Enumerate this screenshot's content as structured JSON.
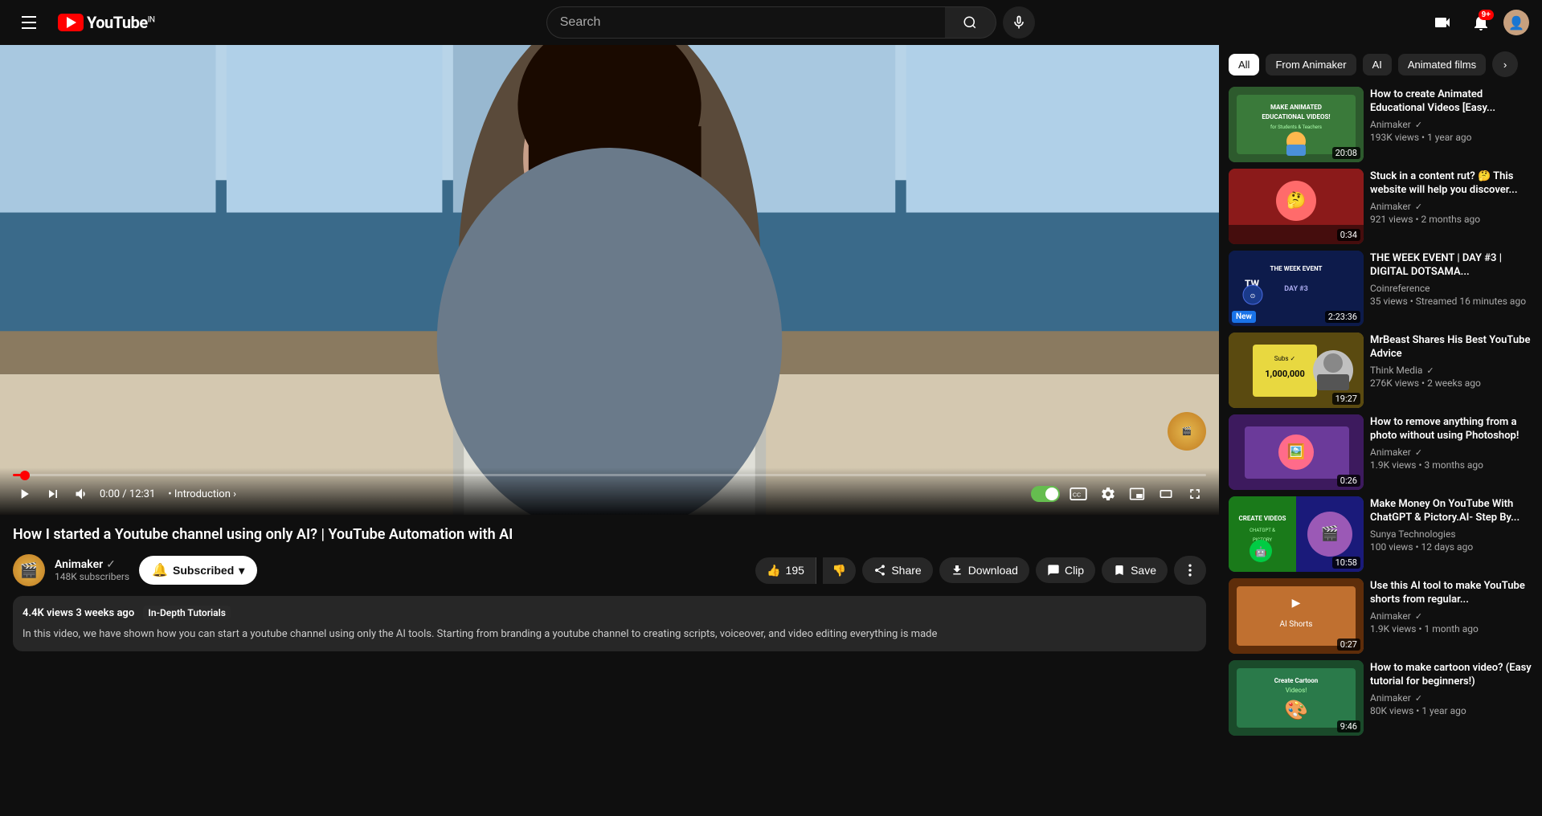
{
  "header": {
    "search_placeholder": "Search",
    "logo_text": "YouTube",
    "logo_sup": "IN",
    "notification_badge": "9+"
  },
  "video": {
    "title": "How I started a Youtube channel using only AI? | YouTube Automation with AI",
    "time_current": "0:00",
    "time_total": "12:31",
    "chapter": "Introduction",
    "views": "4.4K views",
    "posted": "3 weeks ago",
    "category": "In-Depth Tutorials",
    "description": "In this video, we have shown how you can start a youtube channel using only the AI tools. Starting from branding a youtube channel to creating scripts, voiceover, and video editing everything is made"
  },
  "channel": {
    "name": "Animaker",
    "verified": true,
    "subscribers": "148K subscribers",
    "subscribed": true,
    "subscribe_label": "Subscribed",
    "bell_label": "🔔"
  },
  "actions": {
    "like_count": "195",
    "like_label": "👍",
    "dislike_label": "👎",
    "share_label": "Share",
    "download_label": "Download",
    "clip_label": "Clip",
    "save_label": "Save",
    "more_label": "..."
  },
  "filters": {
    "chips": [
      {
        "label": "All",
        "active": true
      },
      {
        "label": "From Animaker",
        "active": false
      },
      {
        "label": "AI",
        "active": false
      },
      {
        "label": "Animated films",
        "active": false
      }
    ]
  },
  "recommendations": [
    {
      "id": 1,
      "title": "How to create Animated Educational Videos [Easy...",
      "channel": "Animaker",
      "verified": true,
      "views": "193K views",
      "age": "1 year ago",
      "duration": "20:08",
      "thumb_class": "thumb-green",
      "thumb_text": "MAKE ANIMATED\nEDUCATIONAL VIDEOS!\nfor Students & Teachers"
    },
    {
      "id": 2,
      "title": "Stuck in a content rut? 🤔 This website will help you discover...",
      "channel": "Animaker",
      "verified": true,
      "views": "921 views",
      "age": "2 months ago",
      "duration": "0:34",
      "thumb_class": "thumb-red",
      "thumb_text": ""
    },
    {
      "id": 3,
      "title": "THE WEEK EVENT | DAY #3 | DIGITAL DOTSAMA...",
      "channel": "Coinreference",
      "verified": false,
      "views": "35 views",
      "age": "Streamed 16 minutes ago",
      "duration": "2:23:36",
      "new_badge": "New",
      "thumb_class": "thumb-dark",
      "thumb_text": "THE WEEK EVENT\nTW DAY #3"
    },
    {
      "id": 4,
      "title": "MrBeast Shares His Best YouTube Advice",
      "channel": "Think Media",
      "verified": true,
      "views": "276K views",
      "age": "2 weeks ago",
      "duration": "19:27",
      "thumb_class": "thumb-yellow",
      "thumb_text": "Subs ✓\n1,000,000"
    },
    {
      "id": 5,
      "title": "How to remove anything from a photo without using Photoshop!",
      "channel": "Animaker",
      "verified": true,
      "views": "1.9K views",
      "age": "3 months ago",
      "duration": "0:26",
      "thumb_class": "thumb-purple",
      "thumb_text": ""
    },
    {
      "id": 6,
      "title": "Make Money On YouTube With ChatGPT & Pictory.AI- Step By...",
      "channel": "Sunya Technologies",
      "verified": false,
      "views": "100 views",
      "age": "12 days ago",
      "duration": "10:58",
      "thumb_class": "thumb-teal",
      "thumb_text": "CREATE VIDEOS\nCHATGPT & PICTORY"
    },
    {
      "id": 7,
      "title": "Use this AI tool to make YouTube shorts from regular...",
      "channel": "Animaker",
      "verified": true,
      "views": "1.9K views",
      "age": "1 month ago",
      "duration": "0:27",
      "thumb_class": "thumb-orange",
      "thumb_text": ""
    },
    {
      "id": 8,
      "title": "How to make cartoon video? (Easy tutorial for beginners!)",
      "channel": "Animaker",
      "verified": true,
      "views": "80K views",
      "age": "1 year ago",
      "duration": "9:46",
      "thumb_class": "thumb-cartoon",
      "thumb_text": "Create Cartoon\nVideos!"
    }
  ]
}
